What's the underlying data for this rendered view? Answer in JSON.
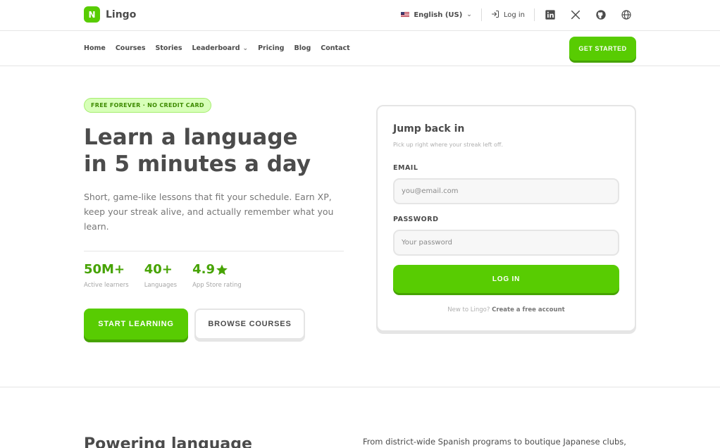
{
  "brand": {
    "logo_letter": "N",
    "name": "Lingo",
    "accent": "#58cc02",
    "accent_dark": "#46a302"
  },
  "topbar": {
    "language": "English (US)",
    "login": "Log in",
    "social_icons": [
      "linkedin-icon",
      "x-icon",
      "github-icon",
      "globe-icon"
    ]
  },
  "nav": {
    "items": [
      {
        "label": "Home"
      },
      {
        "label": "Courses"
      },
      {
        "label": "Stories"
      },
      {
        "label": "Leaderboard",
        "has_dropdown": true
      },
      {
        "label": "Pricing"
      },
      {
        "label": "Blog"
      },
      {
        "label": "Contact"
      }
    ],
    "cta": "GET STARTED"
  },
  "hero": {
    "badge": "FREE FOREVER · NO CREDIT CARD",
    "headline_line1": "Learn a language",
    "headline_line2": "in 5 minutes a day",
    "subtext": "Short, game-like lessons that fit your schedule. Earn XP, keep your streak alive, and actually remember what you learn.",
    "stats": [
      {
        "value": "50M+",
        "label": "Active learners"
      },
      {
        "value": "40+",
        "label": "Languages"
      },
      {
        "value": "4.9",
        "label": "App Store rating",
        "icon": "star-icon"
      }
    ],
    "primary_button": "START LEARNING",
    "secondary_button": "BROWSE COURSES"
  },
  "login_card": {
    "title": "Jump back in",
    "subtitle": "Pick up right where your streak left off.",
    "email_label": "EMAIL",
    "email_placeholder": "you@email.com",
    "password_label": "PASSWORD",
    "password_placeholder": "Your password",
    "submit": "LOG IN",
    "footer_text": "New to Lingo?",
    "footer_link": "Create a free account"
  },
  "bottom": {
    "heading": "Powering language",
    "text": "From district-wide Spanish programs to boutique Japanese clubs,"
  }
}
